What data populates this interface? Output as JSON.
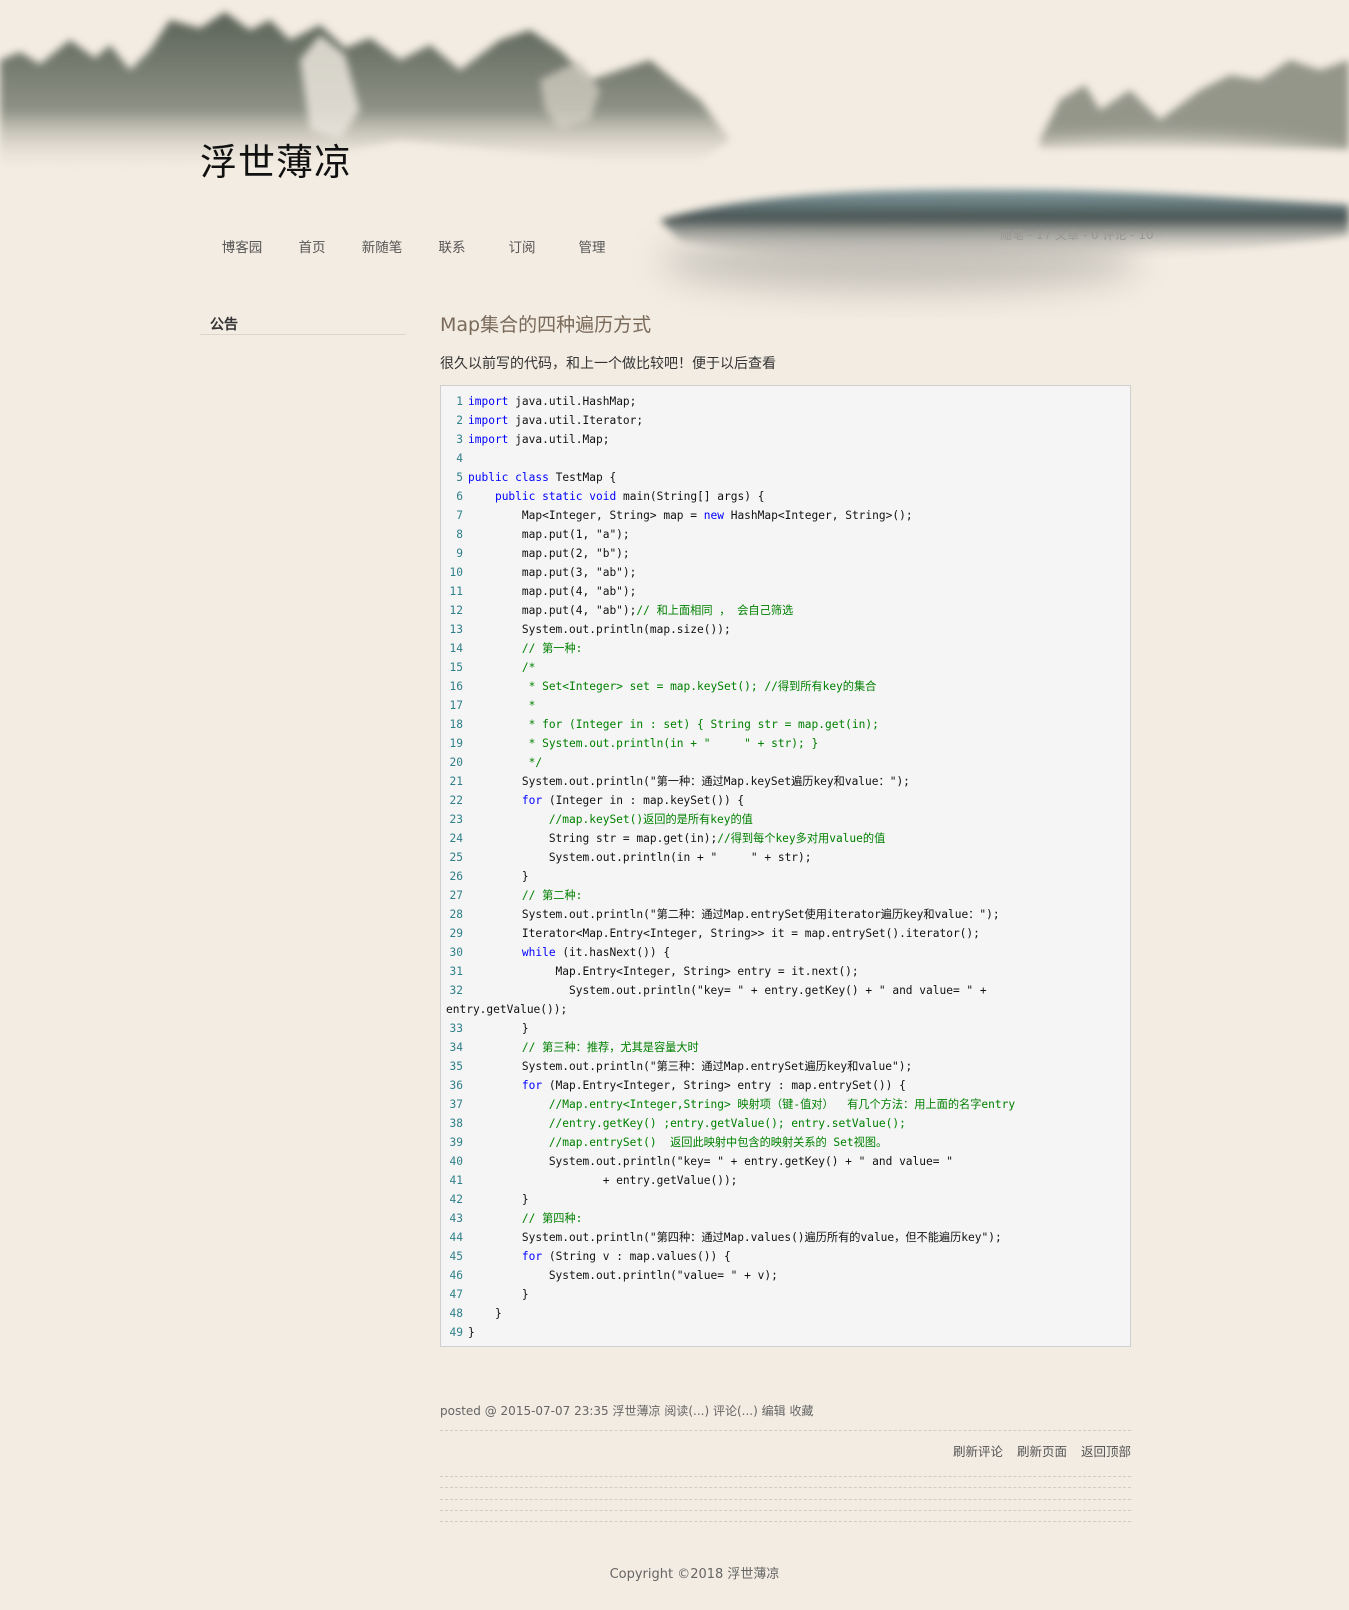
{
  "header": {
    "blog_title": "浮世薄凉"
  },
  "nav": [
    "博客园",
    "首页",
    "新随笔",
    "联系",
    "订阅",
    "管理"
  ],
  "stats": "随笔 - 17  文章 - 0  评论 - 10",
  "sidebar": {
    "notice_title": "公告"
  },
  "post": {
    "title": "Map集合的四种遍历方式",
    "intro": "很久以前写的代码，和上一个做比较吧！便于以后查看",
    "code_lines": [
      {
        "n": "1",
        "t": "import java.util.HashMap;"
      },
      {
        "n": "2",
        "t": "import java.util.Iterator;"
      },
      {
        "n": "3",
        "t": "import java.util.Map;"
      },
      {
        "n": "4",
        "t": ""
      },
      {
        "n": "5",
        "t": "public class TestMap {"
      },
      {
        "n": "6",
        "t": "    public static void main(String[] args) {"
      },
      {
        "n": "7",
        "t": "        Map<Integer, String> map = new HashMap<Integer, String>();"
      },
      {
        "n": "8",
        "t": "        map.put(1, \"a\");"
      },
      {
        "n": "9",
        "t": "        map.put(2, \"b\");"
      },
      {
        "n": "10",
        "t": "        map.put(3, \"ab\");"
      },
      {
        "n": "11",
        "t": "        map.put(4, \"ab\");"
      },
      {
        "n": "12",
        "t": "        map.put(4, \"ab\");// 和上面相同 ， 会自己筛选"
      },
      {
        "n": "13",
        "t": "        System.out.println(map.size());"
      },
      {
        "n": "14",
        "t": "        // 第一种:"
      },
      {
        "n": "15",
        "t": "        /*"
      },
      {
        "n": "16",
        "t": "         * Set<Integer> set = map.keySet(); //得到所有key的集合"
      },
      {
        "n": "17",
        "t": "         *"
      },
      {
        "n": "18",
        "t": "         * for (Integer in : set) { String str = map.get(in);"
      },
      {
        "n": "19",
        "t": "         * System.out.println(in + \"     \" + str); }"
      },
      {
        "n": "20",
        "t": "         */"
      },
      {
        "n": "21",
        "t": "        System.out.println(\"第一种：通过Map.keySet遍历key和value：\");"
      },
      {
        "n": "22",
        "t": "        for (Integer in : map.keySet()) {"
      },
      {
        "n": "23",
        "t": "            //map.keySet()返回的是所有key的值"
      },
      {
        "n": "24",
        "t": "            String str = map.get(in);//得到每个key多对用value的值"
      },
      {
        "n": "25",
        "t": "            System.out.println(in + \"     \" + str);"
      },
      {
        "n": "26",
        "t": "        }"
      },
      {
        "n": "27",
        "t": "        // 第二种:"
      },
      {
        "n": "28",
        "t": "        System.out.println(\"第二种：通过Map.entrySet使用iterator遍历key和value：\");"
      },
      {
        "n": "29",
        "t": "        Iterator<Map.Entry<Integer, String>> it = map.entrySet().iterator();"
      },
      {
        "n": "30",
        "t": "        while (it.hasNext()) {"
      },
      {
        "n": "31",
        "t": "             Map.Entry<Integer, String> entry = it.next();"
      },
      {
        "n": "32",
        "t": "               System.out.println(\"key= \" + entry.getKey() + \" and value= \" +"
      },
      {
        "n": "",
        "t": "entry.getValue());"
      },
      {
        "n": "33",
        "t": "        }"
      },
      {
        "n": "34",
        "t": "        // 第三种：推荐，尤其是容量大时"
      },
      {
        "n": "35",
        "t": "        System.out.println(\"第三种：通过Map.entrySet遍历key和value\");"
      },
      {
        "n": "36",
        "t": "        for (Map.Entry<Integer, String> entry : map.entrySet()) {"
      },
      {
        "n": "37",
        "t": "            //Map.entry<Integer,String> 映射项（键-值对）  有几个方法：用上面的名字entry"
      },
      {
        "n": "38",
        "t": "            //entry.getKey() ;entry.getValue(); entry.setValue();"
      },
      {
        "n": "39",
        "t": "            //map.entrySet()  返回此映射中包含的映射关系的 Set视图。"
      },
      {
        "n": "40",
        "t": "            System.out.println(\"key= \" + entry.getKey() + \" and value= \""
      },
      {
        "n": "41",
        "t": "                    + entry.getValue());"
      },
      {
        "n": "42",
        "t": "        }"
      },
      {
        "n": "43",
        "t": "        // 第四种:"
      },
      {
        "n": "44",
        "t": "        System.out.println(\"第四种：通过Map.values()遍历所有的value，但不能遍历key\");"
      },
      {
        "n": "45",
        "t": "        for (String v : map.values()) {"
      },
      {
        "n": "46",
        "t": "            System.out.println(\"value= \" + v);"
      },
      {
        "n": "47",
        "t": "        }"
      },
      {
        "n": "48",
        "t": "    }"
      },
      {
        "n": "49",
        "t": "}"
      }
    ],
    "footer": {
      "posted": "posted @ 2015-07-07 23:35",
      "author": "浮世薄凉",
      "read": "阅读(...)",
      "comment": "评论(...)",
      "edit": "编辑",
      "favorite": "收藏"
    }
  },
  "comment_links": [
    "刷新评论",
    "刷新页面",
    "返回顶部"
  ],
  "copyright": "Copyright ©2018 浮世薄凉",
  "colors": {
    "background": "#f3ece2",
    "keyword": "#0000ff",
    "comment": "#008000",
    "line_number": "#2f7f8a"
  }
}
